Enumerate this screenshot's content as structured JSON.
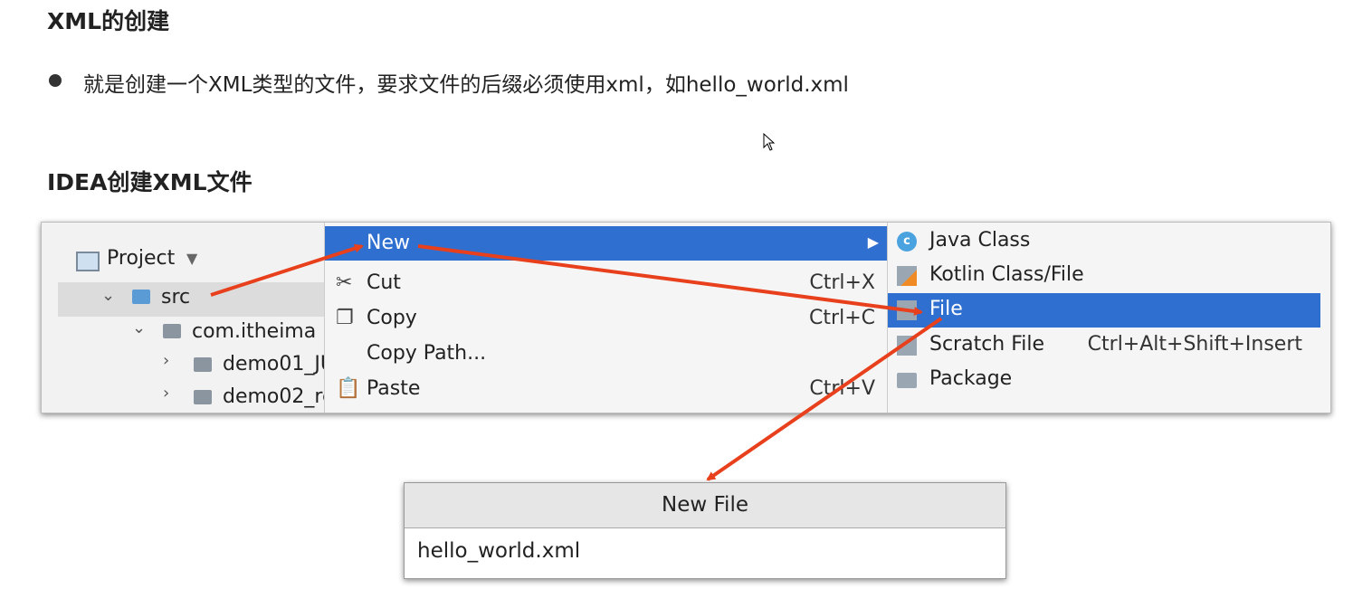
{
  "heading1": "XML的创建",
  "bullet_text": "就是创建一个XML类型的文件，要求文件的后缀必须使用xml，如hello_world.xml",
  "heading2": "IDEA创建XML文件",
  "project": {
    "header": "Project",
    "tree": [
      {
        "label": "src"
      },
      {
        "label": "com.itheima"
      },
      {
        "label": "demo01_JU"
      },
      {
        "label": "demo02_re"
      }
    ]
  },
  "menu": {
    "items": [
      {
        "label": "New",
        "shortcut": "",
        "icon": "",
        "selected": true
      },
      {
        "label": "Cut",
        "shortcut": "Ctrl+X",
        "icon": "scissors-icon"
      },
      {
        "label": "Copy",
        "shortcut": "Ctrl+C",
        "icon": "copy-icon"
      },
      {
        "label": "Copy Path...",
        "shortcut": "",
        "icon": ""
      },
      {
        "label": "Paste",
        "shortcut": "Ctrl+V",
        "icon": "paste-icon"
      }
    ]
  },
  "submenu": {
    "items": [
      {
        "label": "Java Class",
        "shortcut": "",
        "icon": "java-class-icon"
      },
      {
        "label": "Kotlin Class/File",
        "shortcut": "",
        "icon": "kotlin-icon"
      },
      {
        "label": "File",
        "shortcut": "",
        "icon": "file-icon",
        "selected": true
      },
      {
        "label": "Scratch File",
        "shortcut": "Ctrl+Alt+Shift+Insert",
        "icon": "scratch-file-icon"
      },
      {
        "label": "Package",
        "shortcut": "",
        "icon": "package-icon"
      }
    ]
  },
  "dialog": {
    "title": "New File",
    "value": "hello_world.xml"
  },
  "colors": {
    "selection": "#2f6fcf",
    "arrow": "#e8401c"
  }
}
